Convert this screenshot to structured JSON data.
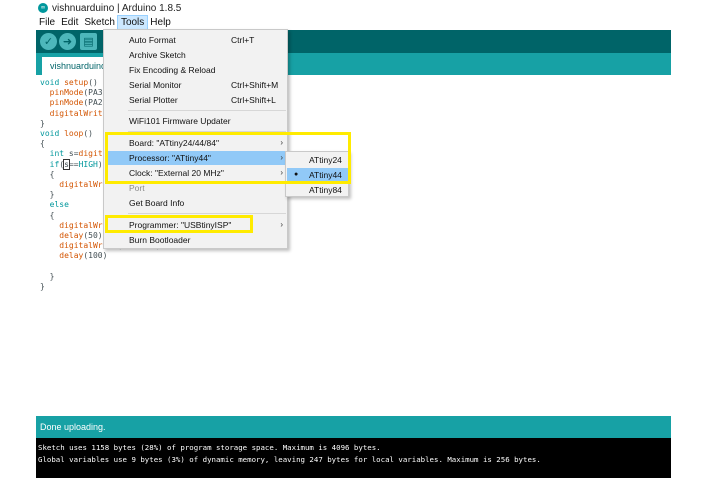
{
  "window": {
    "title": "vishnuarduino | Arduino 1.8.5",
    "icon_label": "∞"
  },
  "menubar": {
    "items": [
      "File",
      "Edit",
      "Sketch",
      "Tools",
      "Help"
    ],
    "active": "Tools"
  },
  "tabs": {
    "active_label": "vishnuarduino"
  },
  "editor": {
    "lines": [
      "void setup()",
      "  pinMode(PA3",
      "  pinMode(PA2",
      "  digitalWrit",
      "}",
      "void loop()",
      "{",
      "  int s=digit",
      "  if(s==HIGH)",
      "  {",
      "    digitalWr",
      "  }",
      "  else",
      "  {",
      "    digitalWr",
      "    delay(50);",
      "    digitalWrite(PA3,LOW);",
      "    delay(100)",
      "",
      "  }",
      "}"
    ]
  },
  "tools_menu": {
    "items": [
      {
        "label": "Auto Format",
        "shortcut": "Ctrl+T"
      },
      {
        "label": "Archive Sketch",
        "shortcut": ""
      },
      {
        "label": "Fix Encoding & Reload",
        "shortcut": ""
      },
      {
        "label": "Serial Monitor",
        "shortcut": "Ctrl+Shift+M"
      },
      {
        "label": "Serial Plotter",
        "shortcut": "Ctrl+Shift+L"
      },
      {
        "label": "WiFi101 Firmware Updater",
        "shortcut": ""
      },
      {
        "label": "Board: \"ATtiny24/44/84\"",
        "shortcut": ""
      },
      {
        "label": "Processor: \"ATtiny44\"",
        "shortcut": ""
      },
      {
        "label": "Clock: \"External 20 MHz\"",
        "shortcut": ""
      },
      {
        "label": "Port",
        "shortcut": ""
      },
      {
        "label": "Get Board Info",
        "shortcut": ""
      },
      {
        "label": "Programmer: \"USBtinyISP\"",
        "shortcut": ""
      },
      {
        "label": "Burn Bootloader",
        "shortcut": ""
      }
    ],
    "submenu_arrow": "›"
  },
  "processor_submenu": {
    "items": [
      "ATtiny24",
      "ATtiny44",
      "ATtiny84"
    ],
    "selected": "ATtiny44",
    "selected_marker": "●"
  },
  "status": {
    "text": "Done uploading."
  },
  "console": {
    "lines": [
      "Sketch uses 1158 bytes (28%) of program storage space. Maximum is 4096 bytes.",
      "Global variables use 9 bytes (3%) of dynamic memory, leaving 247 bytes for local variables. Maximum is 256 bytes."
    ]
  },
  "colors": {
    "toolbar": "#006468",
    "tabbar": "#17a1a5",
    "highlight_box": "#ffeb00",
    "menu_highlight": "#91c9f7"
  },
  "icons": {
    "verify": "verify-icon",
    "upload": "upload-icon",
    "new": "new-sketch-icon"
  }
}
